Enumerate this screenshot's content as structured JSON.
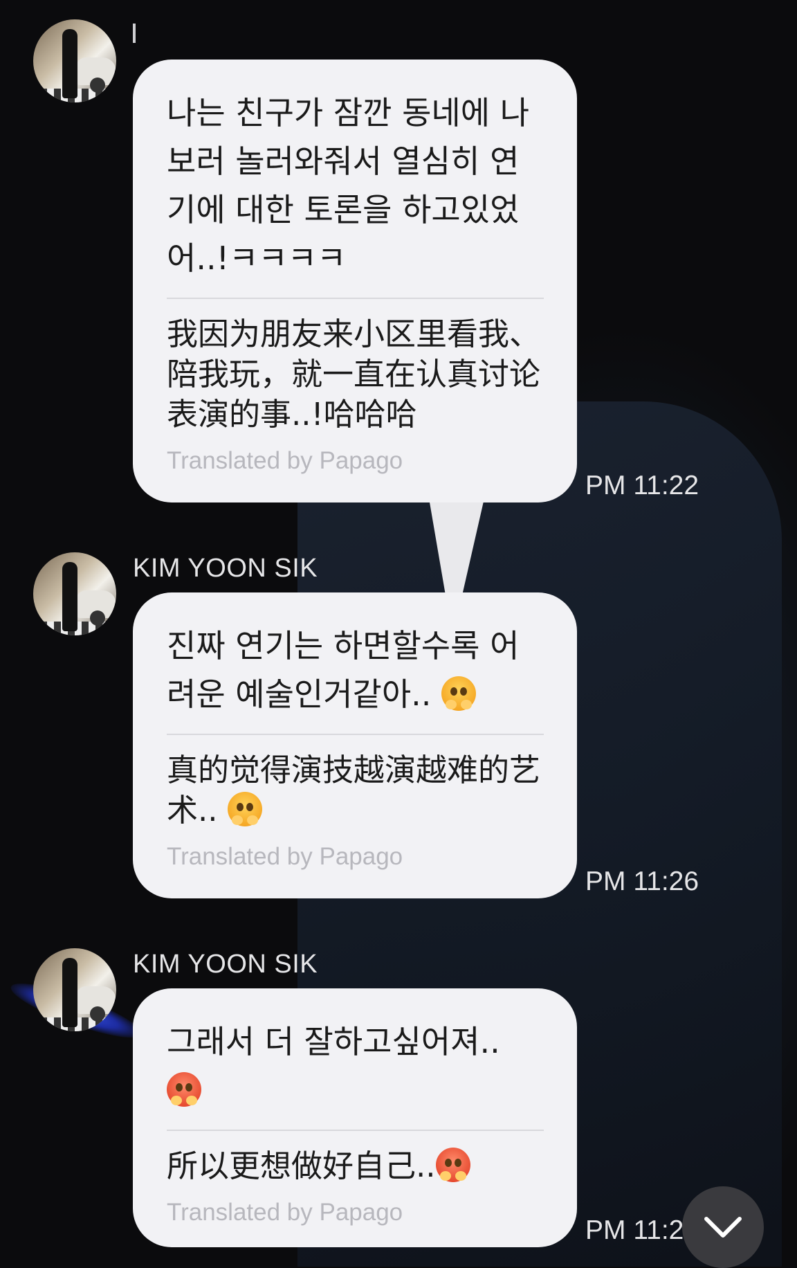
{
  "messages": [
    {
      "sender": "",
      "original": "나는 친구가 잠깐 동네에 나 보러 놀러와줘서 열심히 연기에 대한 토론을 하고있었어..!ㅋㅋㅋㅋ",
      "translation": "我因为朋友来小区里看我、陪我玩，就一直在认真讨论表演的事..!哈哈哈",
      "translated_by": "Translated by Papago",
      "time": "PM 11:22"
    },
    {
      "sender": "KIM YOON SIK",
      "original": "진짜 연기는 하면할수록 어려운 예술인거같아..",
      "original_emoji": "pleading-hands-emoji",
      "translation": "真的觉得演技越演越难的艺术..",
      "translation_emoji": "pleading-hands-emoji",
      "translated_by": "Translated by Papago",
      "time": "PM 11:26"
    },
    {
      "sender": "KIM YOON SIK",
      "original": "그래서 더 잘하고싶어져..",
      "original_emoji": "pouting-steam-emoji",
      "translation": "所以更想做好自己..",
      "translation_emoji": "pouting-steam-emoji",
      "translated_by": "Translated by Papago",
      "time": "PM 11:2"
    }
  ],
  "scroll_button": {
    "icon": "chevron-down-icon"
  }
}
